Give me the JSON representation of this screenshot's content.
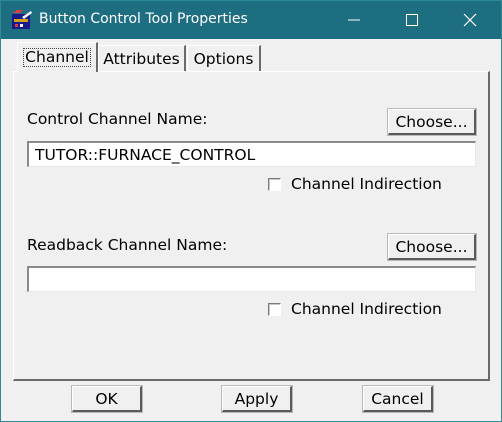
{
  "window": {
    "title": "Button Control Tool Properties",
    "app_icon": "edm-app-icon",
    "controls": {
      "minimize_icon": "minimize-icon",
      "maximize_icon": "maximize-icon",
      "close_icon": "close-icon"
    },
    "titlebar_color": "#1e6e82"
  },
  "tabs": [
    {
      "label": "Channel",
      "active": true
    },
    {
      "label": "Attributes",
      "active": false
    },
    {
      "label": "Options",
      "active": false
    }
  ],
  "channel": {
    "control": {
      "label": "Control Channel Name:",
      "choose_label": "Choose...",
      "value": "TUTOR::FURNACE_CONTROL",
      "indirection_label": "Channel Indirection",
      "indirection_checked": false
    },
    "readback": {
      "label": "Readback Channel Name:",
      "choose_label": "Choose...",
      "value": "",
      "indirection_label": "Channel Indirection",
      "indirection_checked": false
    }
  },
  "footer": {
    "ok_label": "OK",
    "apply_label": "Apply",
    "cancel_label": "Cancel"
  }
}
